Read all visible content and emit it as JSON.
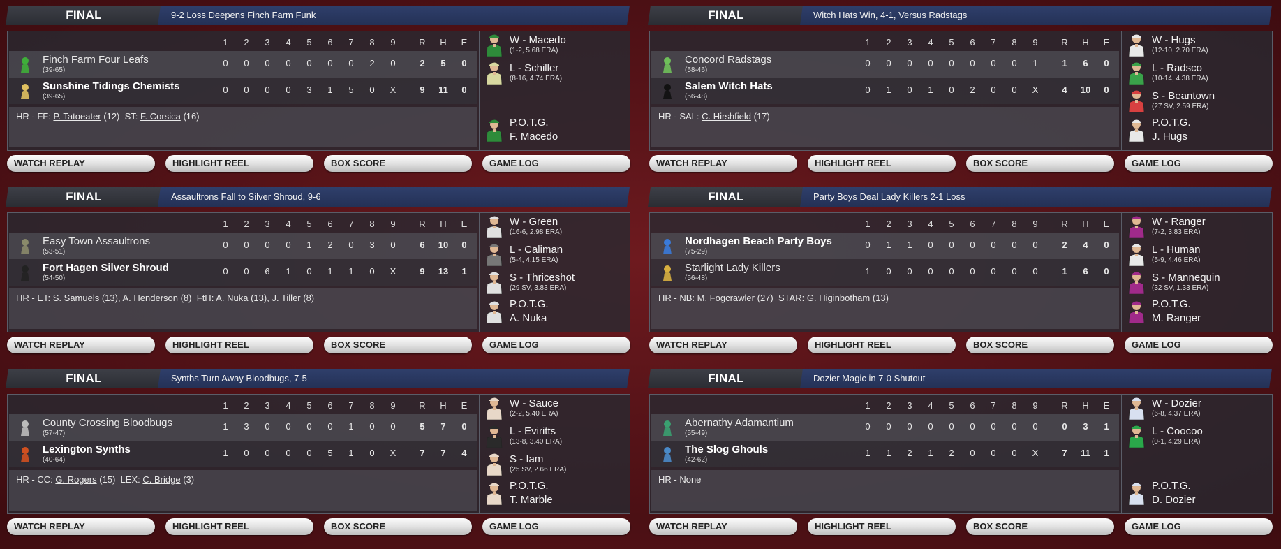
{
  "buttons": {
    "replay": "WATCH REPLAY",
    "highlight": "HIGHLIGHT REEL",
    "box": "BOX SCORE",
    "log": "GAME LOG"
  },
  "innings_header": [
    "1",
    "2",
    "3",
    "4",
    "5",
    "6",
    "7",
    "8",
    "9",
    "R",
    "H",
    "E"
  ],
  "games": [
    {
      "status": "FINAL",
      "headline": "9-2 Loss Deepens Finch Farm Funk",
      "teams": [
        {
          "name": "Finch Farm Four Leafs",
          "record": "(39-65)",
          "winner": false,
          "logo_color": "#3fae3a",
          "innings": [
            "0",
            "0",
            "0",
            "0",
            "0",
            "0",
            "0",
            "2",
            "0"
          ],
          "r": "2",
          "h": "5",
          "e": "0"
        },
        {
          "name": "Sunshine Tidings Chemists",
          "record": "(39-65)",
          "winner": true,
          "logo_color": "#e0c060",
          "innings": [
            "0",
            "0",
            "0",
            "0",
            "3",
            "1",
            "5",
            "0",
            "X"
          ],
          "r": "9",
          "h": "11",
          "e": "0"
        }
      ],
      "hr_prefix": "HR - FF:",
      "hr": [
        {
          "pl": "P. Tatoeater",
          "n": "(12)"
        }
      ],
      "hr_prefix2": "ST:",
      "hr2": [
        {
          "pl": "F. Corsica",
          "n": "(16)"
        }
      ],
      "pitchers": [
        {
          "name": "W - Macedo",
          "stat": "(1-2, 5.68 ERA)",
          "jersey": "#2e8b3a"
        },
        {
          "name": "L - Schiller",
          "stat": "(8-16, 4.74 ERA)",
          "jersey": "#d8d8a0"
        }
      ],
      "potg_label": "P.O.T.G.",
      "potg_name": "F. Macedo",
      "potg_jersey": "#2e8b3a"
    },
    {
      "status": "FINAL",
      "headline": "Witch Hats Win, 4-1, Versus Radstags",
      "teams": [
        {
          "name": "Concord Radstags",
          "record": "(58-46)",
          "winner": false,
          "logo_color": "#6fbf5a",
          "innings": [
            "0",
            "0",
            "0",
            "0",
            "0",
            "0",
            "0",
            "0",
            "1"
          ],
          "r": "1",
          "h": "6",
          "e": "0"
        },
        {
          "name": "Salem Witch Hats",
          "record": "(56-48)",
          "winner": true,
          "logo_color": "#111111",
          "innings": [
            "0",
            "1",
            "0",
            "1",
            "0",
            "2",
            "0",
            "0",
            "X"
          ],
          "r": "4",
          "h": "10",
          "e": "0"
        }
      ],
      "hr_prefix": "HR - SAL:",
      "hr": [
        {
          "pl": "C. Hirshfield",
          "n": "(17)"
        }
      ],
      "hr_prefix2": "",
      "hr2": [],
      "pitchers": [
        {
          "name": "W - Hugs",
          "stat": "(12-10, 2.70 ERA)",
          "jersey": "#e8e8e8"
        },
        {
          "name": "L - Radsco",
          "stat": "(10-14, 4.38 ERA)",
          "jersey": "#3aa24a"
        },
        {
          "name": "S - Beantown",
          "stat": "(27 SV, 2.59 ERA)",
          "jersey": "#d84040"
        }
      ],
      "potg_label": "P.O.T.G.",
      "potg_name": "J. Hugs",
      "potg_jersey": "#e8e8e8"
    },
    {
      "status": "FINAL",
      "headline": "Assaultrons Fall to Silver Shroud, 9-6",
      "teams": [
        {
          "name": "Easy Town Assaultrons",
          "record": "(53-51)",
          "winner": false,
          "logo_color": "#8a8a6a",
          "innings": [
            "0",
            "0",
            "0",
            "0",
            "1",
            "2",
            "0",
            "3",
            "0"
          ],
          "r": "6",
          "h": "10",
          "e": "0"
        },
        {
          "name": "Fort Hagen Silver Shroud",
          "record": "(54-50)",
          "winner": true,
          "logo_color": "#222222",
          "innings": [
            "0",
            "0",
            "6",
            "1",
            "0",
            "1",
            "1",
            "0",
            "X"
          ],
          "r": "9",
          "h": "13",
          "e": "1"
        }
      ],
      "hr_prefix": "HR - ET:",
      "hr": [
        {
          "pl": "S. Samuels",
          "n": "(13),"
        },
        {
          "pl": "A. Henderson",
          "n": "(8)"
        }
      ],
      "hr_prefix2": "FtH:",
      "hr2": [
        {
          "pl": "A. Nuka",
          "n": "(13),"
        },
        {
          "pl": "J. Tiller",
          "n": "(8)"
        }
      ],
      "pitchers": [
        {
          "name": "W - Green",
          "stat": "(16-6, 2.98 ERA)",
          "jersey": "#e0e0e0"
        },
        {
          "name": "L - Caliman",
          "stat": "(5-4, 4.15 ERA)",
          "jersey": "#777777"
        },
        {
          "name": "S - Thriceshot",
          "stat": "(29 SV, 3.83 ERA)",
          "jersey": "#e0e0e0"
        }
      ],
      "potg_label": "P.O.T.G.",
      "potg_name": "A. Nuka",
      "potg_jersey": "#e0e0e0"
    },
    {
      "status": "FINAL",
      "headline": "Party Boys Deal Lady Killers 2-1 Loss",
      "teams": [
        {
          "name": "Nordhagen Beach Party Boys",
          "record": "(75-29)",
          "winner": true,
          "logo_color": "#3a7ad8",
          "innings": [
            "0",
            "1",
            "1",
            "0",
            "0",
            "0",
            "0",
            "0",
            "0"
          ],
          "r": "2",
          "h": "4",
          "e": "0"
        },
        {
          "name": "Starlight Lady Killers",
          "record": "(56-48)",
          "winner": false,
          "logo_color": "#d8b040",
          "innings": [
            "1",
            "0",
            "0",
            "0",
            "0",
            "0",
            "0",
            "0",
            "0"
          ],
          "r": "1",
          "h": "6",
          "e": "0"
        }
      ],
      "hr_prefix": "HR - NB:",
      "hr": [
        {
          "pl": "M. Fogcrawler",
          "n": "(27)"
        }
      ],
      "hr_prefix2": "STAR:",
      "hr2": [
        {
          "pl": "G. Higinbotham",
          "n": "(13)"
        }
      ],
      "pitchers": [
        {
          "name": "W - Ranger",
          "stat": "(7-2, 3.83 ERA)",
          "jersey": "#a02a8a"
        },
        {
          "name": "L - Human",
          "stat": "(5-9, 4.46 ERA)",
          "jersey": "#e8e8e8"
        },
        {
          "name": "S - Mannequin",
          "stat": "(32 SV, 1.33 ERA)",
          "jersey": "#a02a8a"
        }
      ],
      "potg_label": "P.O.T.G.",
      "potg_name": "M. Ranger",
      "potg_jersey": "#a02a8a"
    },
    {
      "status": "FINAL",
      "headline": "Synths Turn Away Bloodbugs, 7-5",
      "teams": [
        {
          "name": "County Crossing Bloodbugs",
          "record": "(57-47)",
          "winner": false,
          "logo_color": "#bbbbbb",
          "innings": [
            "1",
            "3",
            "0",
            "0",
            "0",
            "0",
            "1",
            "0",
            "0"
          ],
          "r": "5",
          "h": "7",
          "e": "0"
        },
        {
          "name": "Lexington Synths",
          "record": "(40-64)",
          "winner": true,
          "logo_color": "#d05020",
          "innings": [
            "1",
            "0",
            "0",
            "0",
            "0",
            "5",
            "1",
            "0",
            "X"
          ],
          "r": "7",
          "h": "7",
          "e": "4"
        }
      ],
      "hr_prefix": "HR - CC:",
      "hr": [
        {
          "pl": "G. Rogers",
          "n": "(15)"
        }
      ],
      "hr_prefix2": "LEX:",
      "hr2": [
        {
          "pl": "C. Bridge",
          "n": "(3)"
        }
      ],
      "pitchers": [
        {
          "name": "W - Sauce",
          "stat": "(2-2, 5.40 ERA)",
          "jersey": "#e8d8c8"
        },
        {
          "name": "L - Eviritts",
          "stat": "(13-8, 3.40 ERA)",
          "jersey": "#2a2a2a"
        },
        {
          "name": "S - Iam",
          "stat": "(25 SV, 2.66 ERA)",
          "jersey": "#e8d8c8"
        }
      ],
      "potg_label": "P.O.T.G.",
      "potg_name": "T. Marble",
      "potg_jersey": "#e8d8c8"
    },
    {
      "status": "FINAL",
      "headline": "Dozier Magic in 7-0 Shutout",
      "teams": [
        {
          "name": "Abernathy Adamantium",
          "record": "(55-49)",
          "winner": false,
          "logo_color": "#3aa070",
          "innings": [
            "0",
            "0",
            "0",
            "0",
            "0",
            "0",
            "0",
            "0",
            "0"
          ],
          "r": "0",
          "h": "3",
          "e": "1"
        },
        {
          "name": "The Slog Ghouls",
          "record": "(42-62)",
          "winner": true,
          "logo_color": "#4a8ac8",
          "innings": [
            "1",
            "1",
            "2",
            "1",
            "2",
            "0",
            "0",
            "0",
            "X"
          ],
          "r": "7",
          "h": "11",
          "e": "1"
        }
      ],
      "hr_prefix": "HR - None",
      "hr": [],
      "hr_prefix2": "",
      "hr2": [],
      "pitchers": [
        {
          "name": "W - Dozier",
          "stat": "(6-8, 4.37 ERA)",
          "jersey": "#d8e0f0"
        },
        {
          "name": "L - Coocoo",
          "stat": "(0-1, 4.29 ERA)",
          "jersey": "#2aa84a"
        }
      ],
      "potg_label": "P.O.T.G.",
      "potg_name": "D. Dozier",
      "potg_jersey": "#d8e0f0"
    }
  ]
}
